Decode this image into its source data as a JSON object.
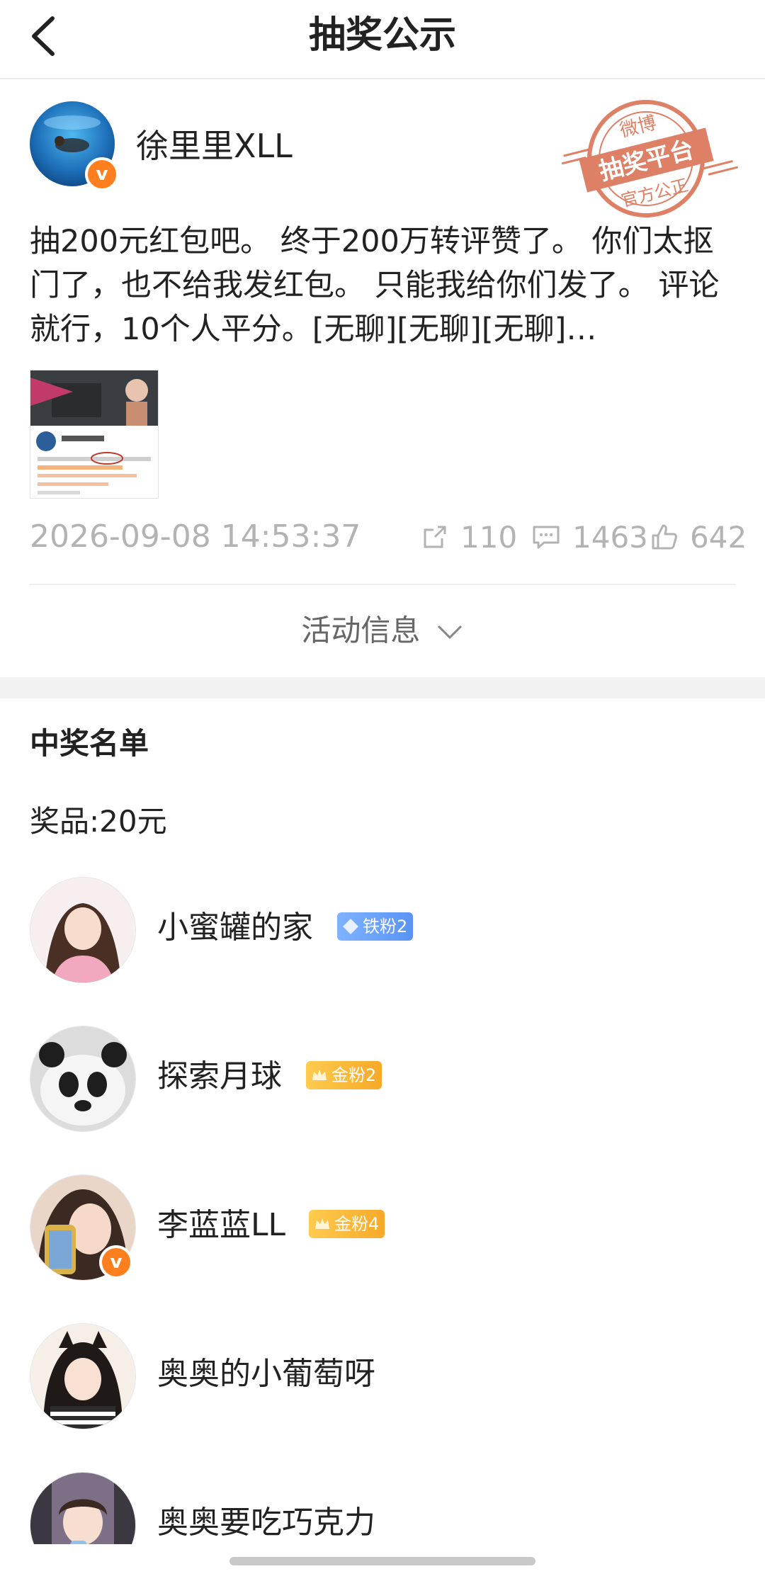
{
  "header": {
    "title": "抽奖公示"
  },
  "post": {
    "author": "徐里里XLL",
    "stamp": {
      "top": "微博",
      "middle": "抽奖平台",
      "bottom": "官方公正"
    },
    "text": "抽200元红包吧。 终于200万转评赞了。 你们太抠门了，也不给我发红包。 只能我给你们发了。 评论就行，10个人平分。[无聊][无聊][无聊]  http://t.cn/lottery",
    "time": "2026-09-08 14:53:37",
    "reposts": "110",
    "comments": "1463",
    "likes": "642"
  },
  "activity_info_label": "活动信息",
  "winners_section": {
    "title": "中奖名单",
    "prize": "奖品:20元",
    "winners": [
      {
        "name": "小蜜罐的家",
        "badge": "铁粉2",
        "badge_type": "iron"
      },
      {
        "name": "探索月球",
        "badge": "金粉2",
        "badge_type": "gold"
      },
      {
        "name": "李蓝蓝LL",
        "badge": "金粉4",
        "badge_type": "gold",
        "verified": true
      },
      {
        "name": "奥奥的小葡萄呀"
      },
      {
        "name": "奥奥要吃巧克力"
      }
    ]
  },
  "colors": {
    "accent_orange": "#ff7f1e",
    "stamp_red": "#d96a4c",
    "muted_gray": "#b3b3b3"
  }
}
